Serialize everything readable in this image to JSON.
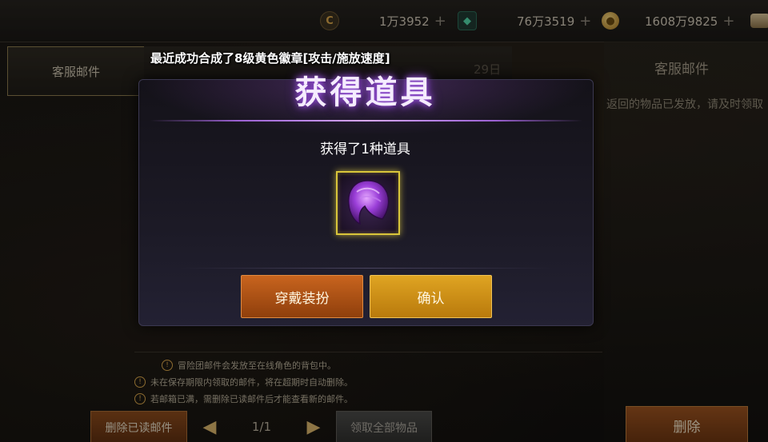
{
  "currency": {
    "c_value": "1万3952",
    "gem_value": "76万3519",
    "gold_value": "1608万9825",
    "plus": "+",
    "c_icon": "C"
  },
  "mail": {
    "tab_label": "客服邮件",
    "day_label": "29日",
    "notice_text": "最近成功合成了8级黄色徽章[攻击/施放速度]"
  },
  "right_panel": {
    "title": "客服邮件",
    "body_text": "返回的物品已发放，请及时领取"
  },
  "tips": [
    "冒险团邮件会发放至在线角色的背包中。",
    "未在保存期限内领取的邮件，将在超期时自动删除。",
    "若邮箱已满，需删除已读邮件后才能查看新的邮件。"
  ],
  "bottom": {
    "delete_read_label": "删除已读邮件",
    "page_indicator": "1/1",
    "claim_all_label": "领取全部物品",
    "delete_label": "删除"
  },
  "modal": {
    "title": "获得道具",
    "subtitle": "获得了1种道具",
    "item_icon": "purple-hair-icon",
    "wear_label": "穿戴装扮",
    "confirm_label": "确认"
  },
  "colors": {
    "accent_gold": "#dfa422",
    "accent_orange": "#c8641e",
    "title_glow": "#a05ae0",
    "item_border": "#d9c53a"
  }
}
